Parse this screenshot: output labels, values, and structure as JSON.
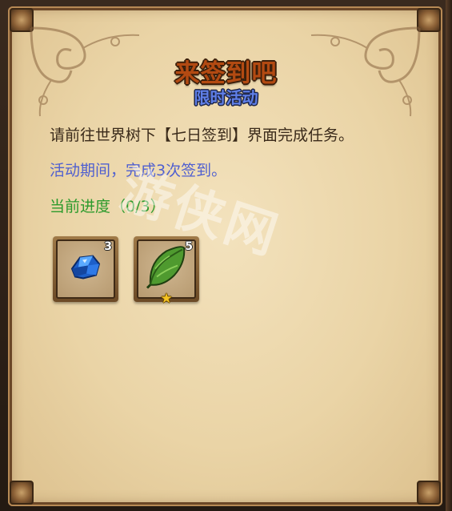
{
  "panel": {
    "title": "来签到吧",
    "subtitle": "限时活动",
    "description": "请前往世界树下【七日签到】界面完成任务。",
    "period": "活动期间，完成3次签到。",
    "progress": "当前进度（0/3）"
  },
  "rewards": [
    {
      "icon": "blue-crystal-icon",
      "count": "3",
      "starred": false
    },
    {
      "icon": "green-leaf-icon",
      "count": "5",
      "starred": true
    }
  ],
  "watermark": "游侠网",
  "colors": {
    "title": "#b34a12",
    "subtitle": "#5f7fe8",
    "period_text": "#4f5fd0",
    "progress_text": "#2c9a2c",
    "parchment": "#ead4a6"
  }
}
